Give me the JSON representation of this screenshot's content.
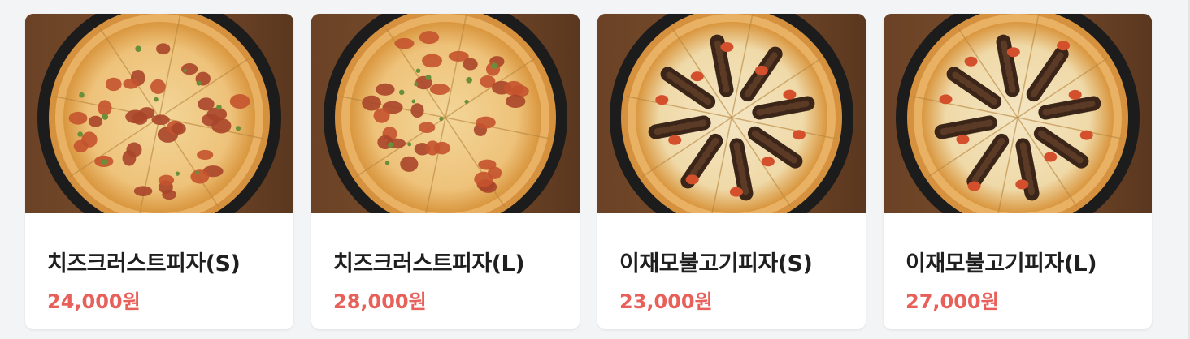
{
  "colors": {
    "price": "#e8605a",
    "name": "#1f1f1f",
    "card_bg": "#ffffff",
    "page_bg": "#f3f4f6"
  },
  "products": [
    {
      "name": "치즈크러스트피자(S)",
      "price": "24,000원",
      "image_icon": "cheese-crust-pizza-image",
      "topping": "pepperoni"
    },
    {
      "name": "치즈크러스트피자(L)",
      "price": "28,000원",
      "image_icon": "cheese-crust-pizza-image",
      "topping": "pepperoni"
    },
    {
      "name": "이재모불고기피자(S)",
      "price": "23,000원",
      "image_icon": "bulgogi-pizza-image",
      "topping": "bulgogi"
    },
    {
      "name": "이재모불고기피자(L)",
      "price": "27,000원",
      "image_icon": "bulgogi-pizza-image",
      "topping": "bulgogi"
    }
  ]
}
